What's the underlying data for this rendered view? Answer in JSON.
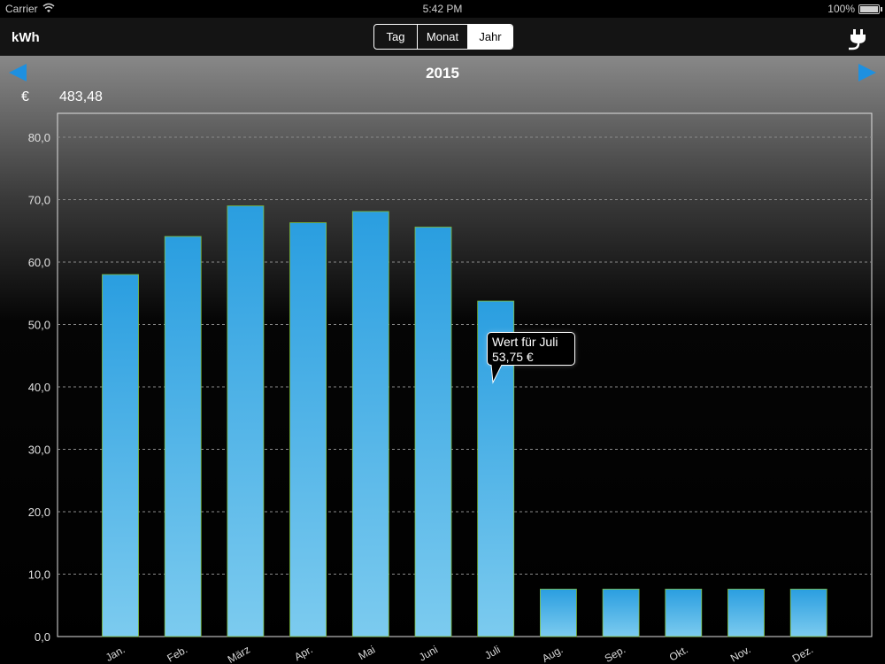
{
  "status_bar": {
    "carrier": "Carrier",
    "time": "5:42 PM",
    "battery": "100%"
  },
  "nav": {
    "unit": "kWh",
    "segments": [
      "Tag",
      "Monat",
      "Jahr"
    ],
    "selected_segment": "Jahr"
  },
  "header": {
    "year": "2015",
    "currency": "€",
    "total": "483,48"
  },
  "tooltip": {
    "line1": "Wert für Juli",
    "line2": "53,75 €"
  },
  "colors": {
    "bar_top": "#2a9ee0",
    "bar_bottom": "#7ccbef",
    "accent_blue": "#1e90e0"
  },
  "chart_data": {
    "type": "bar",
    "categories": [
      "Jan.",
      "Feb.",
      "März",
      "Apr.",
      "Mai",
      "Juni",
      "Juli",
      "Aug.",
      "Sep.",
      "Okt.",
      "Nov.",
      "Dez."
    ],
    "values": [
      58.0,
      64.1,
      69.0,
      66.3,
      68.1,
      65.6,
      53.75,
      7.6,
      7.6,
      7.6,
      7.6,
      7.6
    ],
    "ylim": [
      0,
      80
    ],
    "yticks": [
      "0,0",
      "10,0",
      "20,0",
      "30,0",
      "40,0",
      "50,0",
      "60,0",
      "70,0",
      "80,0"
    ],
    "grid": true
  }
}
